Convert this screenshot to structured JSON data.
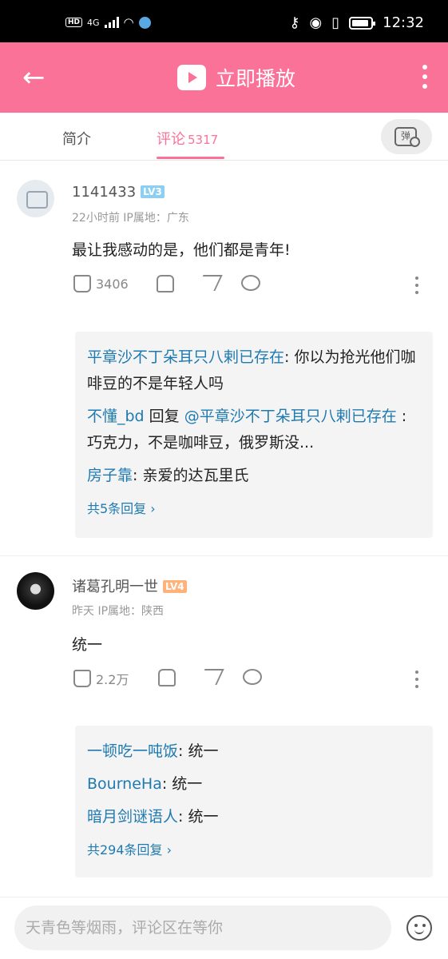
{
  "status_bar": {
    "network_badge": "HD",
    "network_type": "4G",
    "time": "12:32"
  },
  "topbar": {
    "play_label": "立即播放"
  },
  "tabs": [
    {
      "label": "简介"
    },
    {
      "label": "评论",
      "count": "5317"
    }
  ],
  "comments": [
    {
      "username": "1141433",
      "level": "LV3",
      "meta": "22小时前  IP属地：广东",
      "text": "最让我感动的是，他们都是青年!",
      "likes": "3406",
      "replies": [
        {
          "user": "平章沙不丁朵耳只八剌已存在",
          "sep": ": ",
          "text": "你以为抢光他们咖啡豆的不是年轻人吗"
        },
        {
          "user": "不懂_bd",
          "mid": " 回复 ",
          "target": "@平章沙不丁朵耳只八剌已存在",
          "text": " :巧克力，不是咖啡豆，俄罗斯没..."
        },
        {
          "user": "房子靠",
          "sep": ": ",
          "text": "亲爱的达瓦里氏"
        }
      ],
      "more_replies": "共5条回复"
    },
    {
      "username": "诸葛孔明一世",
      "level": "LV4",
      "meta": "昨天  IP属地：陕西",
      "text": "统一",
      "likes": "2.2万",
      "replies": [
        {
          "user": "一顿吃一吨饭",
          "sep": ": ",
          "text": "统一"
        },
        {
          "user": "BourneHa",
          "sep": ": ",
          "text": "统一"
        },
        {
          "user": "暗月剑谜语人",
          "sep": ": ",
          "text": "统一"
        }
      ],
      "more_replies": "共294条回复"
    }
  ],
  "input": {
    "placeholder": "天青色等烟雨，评论区在等你"
  },
  "colors": {
    "brand_pink": "#fb7299",
    "reply_user_blue": "#1e7ab0",
    "lv3": "#8ccff0",
    "lv4": "#ffb37a"
  }
}
